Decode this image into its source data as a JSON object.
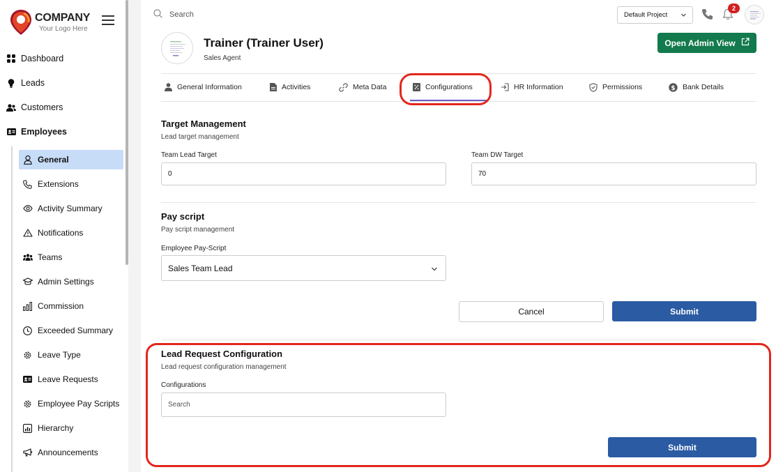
{
  "brand": {
    "name": "COMPANY",
    "tagline": "Your Logo Here",
    "accent": "#e4261c"
  },
  "sidebar": {
    "top_items": [
      {
        "label": "Dashboard",
        "icon": "grid-icon"
      },
      {
        "label": "Leads",
        "icon": "lightbulb-icon"
      },
      {
        "label": "Customers",
        "icon": "users-icon"
      },
      {
        "label": "Employees",
        "icon": "id-card-icon"
      }
    ],
    "sub_items": [
      {
        "label": "General",
        "icon": "user-icon",
        "active": true
      },
      {
        "label": "Extensions",
        "icon": "phone-icon"
      },
      {
        "label": "Activity Summary",
        "icon": "eye-icon"
      },
      {
        "label": "Notifications",
        "icon": "warning-icon"
      },
      {
        "label": "Teams",
        "icon": "team-icon"
      },
      {
        "label": "Admin Settings",
        "icon": "graduation-cap-icon"
      },
      {
        "label": "Commission",
        "icon": "bar-chart-icon"
      },
      {
        "label": "Exceeded Summary",
        "icon": "clock-icon"
      },
      {
        "label": "Leave Type",
        "icon": "gear-icon"
      },
      {
        "label": "Leave Requests",
        "icon": "id-card-icon"
      },
      {
        "label": "Employee Pay Scripts",
        "icon": "gear-icon"
      },
      {
        "label": "Hierarchy",
        "icon": "chart-box-icon"
      },
      {
        "label": "Announcements",
        "icon": "megaphone-icon"
      }
    ]
  },
  "topbar": {
    "search_placeholder": "Search",
    "project": "Default Project",
    "notification_count": "2"
  },
  "profile": {
    "name": "Trainer (Trainer User)",
    "role": "Sales Agent",
    "admin_button": "Open Admin View"
  },
  "tabs": [
    {
      "label": "General Information",
      "icon": "user-icon"
    },
    {
      "label": "Activities",
      "icon": "document-icon"
    },
    {
      "label": "Meta Data",
      "icon": "link-icon"
    },
    {
      "label": "Configurations",
      "icon": "percent-doc-icon",
      "active": true
    },
    {
      "label": "HR Information",
      "icon": "sign-in-icon"
    },
    {
      "label": "Permissions",
      "icon": "shield-icon"
    },
    {
      "label": "Bank Details",
      "icon": "dollar-icon"
    }
  ],
  "target": {
    "title": "Target Management",
    "subtitle": "Lead target management",
    "lead_label": "Team Lead Target",
    "lead_value": "0",
    "dw_label": "Team DW Target",
    "dw_value": "70"
  },
  "payscript": {
    "title": "Pay script",
    "subtitle": "Pay script management",
    "label": "Employee Pay-Script",
    "value": "Sales Team Lead",
    "cancel": "Cancel",
    "submit": "Submit"
  },
  "lead_request": {
    "title": "Lead Request Configuration",
    "subtitle": "Lead request configuration management",
    "label": "Configurations",
    "placeholder": "Search",
    "submit": "Submit"
  }
}
